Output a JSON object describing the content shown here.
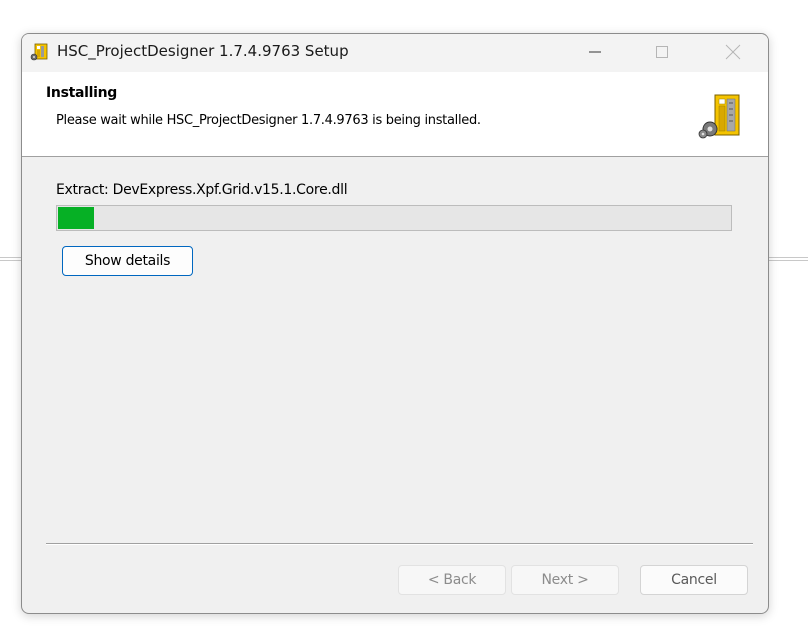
{
  "window": {
    "title": "HSC_ProjectDesigner 1.7.4.9763 Setup",
    "icon": "installer-package-icon",
    "controls": {
      "minimize_icon": "minimize-icon",
      "maximize_icon": "maximize-icon",
      "close_icon": "close-icon"
    }
  },
  "header": {
    "title": "Installing",
    "subtitle": "Please wait while HSC_ProjectDesigner 1.7.4.9763 is being installed.",
    "icon": "installer-package-icon"
  },
  "progress": {
    "status_text": "Extract: DevExpress.Xpf.Grid.v15.1.Core.dll",
    "fraction": 0.053,
    "color": "#06b025"
  },
  "buttons": {
    "show_details": "Show details",
    "back": "< Back",
    "next": "Next >",
    "cancel": "Cancel"
  },
  "colors": {
    "accent_border": "#0067c0",
    "progress_fill": "#06b025",
    "disabled_text": "#8c8c8c"
  }
}
